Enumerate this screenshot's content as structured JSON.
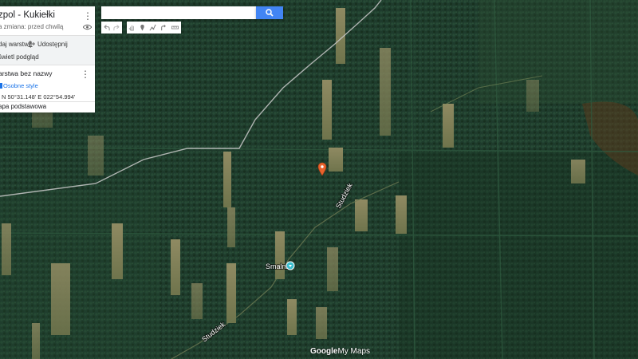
{
  "panel": {
    "title": "zpol - Kukiełki",
    "subtitle": "a zmiana: przed chwilą",
    "actions": {
      "add_layer": "daj warstwę",
      "share": "Udostępnij",
      "preview": "świetl podgląd"
    },
    "layer": {
      "title": "arstwa bez nazwy",
      "style_link": "Osobne style",
      "coords": "N 50°31.148' E 022°54.994'"
    },
    "basemap": "apa podstawowa"
  },
  "search": {
    "value": "",
    "placeholder": ""
  },
  "toolbar": {
    "buttons": [
      "undo-icon",
      "redo-icon",
      "hand-icon",
      "marker-icon",
      "line-icon",
      "route-icon",
      "ruler-icon"
    ]
  },
  "map": {
    "labels": {
      "stream_north": "Studziek",
      "place": "Smalnik",
      "stream_south": "Studziek"
    }
  },
  "attribution": {
    "google": "Google",
    "mymaps": "My Maps"
  },
  "colors": {
    "accent": "#4285f4",
    "marker": "#e8622c",
    "poi": "#3cbfcf",
    "link": "#1a73e8"
  }
}
